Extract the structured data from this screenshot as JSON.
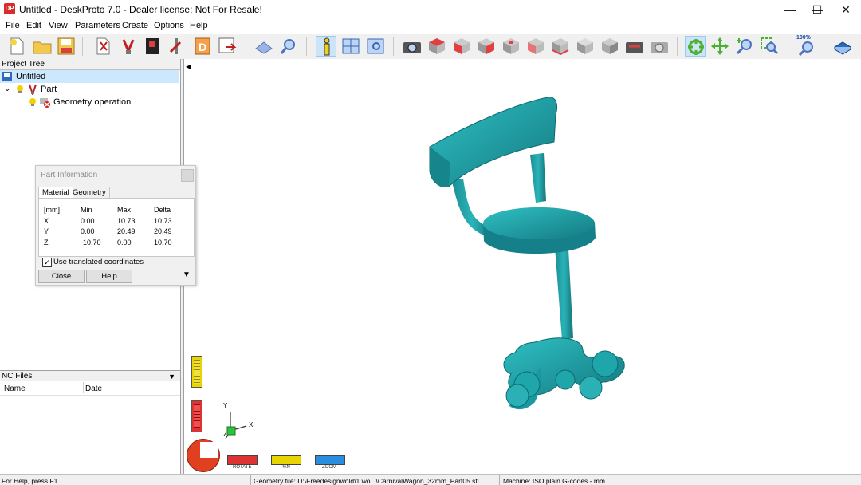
{
  "window": {
    "icon_text": "DP",
    "title": "Untitled - DeskProto 7.0 - Dealer license: Not For Resale!",
    "minimize": "—",
    "maximize": "☐",
    "close": "✕"
  },
  "menu": [
    "File",
    "Edit",
    "View",
    "Parameters",
    "Create",
    "Options",
    "Help"
  ],
  "toolbar": {
    "icons": [
      "new-icon",
      "open-icon",
      "save-icon",
      "import-geometry-icon",
      "import-vector-icon",
      "import-bitmap-icon",
      "create-vector-icon",
      "create-bitmap-icon",
      "export-icon",
      "cut-icon",
      "search-icon",
      "info-icon",
      "viewport-icon",
      "preview-icon",
      "snapshot-icon",
      "view-top-icon",
      "view-front-icon",
      "view-right-icon",
      "view-back-icon",
      "view-left-icon",
      "view-bottom-icon",
      "view-iso-icon",
      "view-iso2-icon",
      "view-rotate-icon",
      "view-reset-icon",
      "rotate-mode-icon",
      "pan-mode-icon",
      "zoom-mode-icon",
      "zoom-window-icon",
      "zoom-100-icon",
      "book-icon"
    ],
    "zoom_label": "100%",
    "accent": "#cce4f7"
  },
  "project_tree": {
    "header": "Project Tree",
    "items": [
      {
        "label": "Untitled",
        "level": 0,
        "selected": true
      },
      {
        "label": "Part",
        "level": 1,
        "selected": false
      },
      {
        "label": "Geometry operation",
        "level": 2,
        "selected": false
      }
    ]
  },
  "part_info": {
    "title": "Part Information",
    "tabs": [
      "Material",
      "Geometry"
    ],
    "columns": [
      "[mm]",
      "Min",
      "Max",
      "Delta"
    ],
    "rows": [
      [
        "X",
        "0.00",
        "10.73",
        "10.73"
      ],
      [
        "Y",
        "0.00",
        "20.49",
        "20.49"
      ],
      [
        "Z",
        "-10.70",
        "0.00",
        "10.70"
      ]
    ],
    "checkbox_label": "Use translated coordinates",
    "checkbox_checked": "✓",
    "close_button": "Close",
    "help_button": "Help"
  },
  "nc_files": {
    "header": "NC Files",
    "columns": [
      "Name",
      "Date"
    ]
  },
  "viewport": {
    "axis_x": "X",
    "axis_y": "Y",
    "axis_z": "Z",
    "mode_labels": [
      "ROTATE",
      "PAN",
      "ZOOM"
    ],
    "model_color": "#1fa0a6"
  },
  "statusbar": {
    "help": "For Help, press F1",
    "geometry": "Geometry file: D:\\Freedesignwold\\1.wo...\\CarnivalWagon_32mm_Part05.stl",
    "machine": "Machine: ISO plain G-codes - mm"
  }
}
